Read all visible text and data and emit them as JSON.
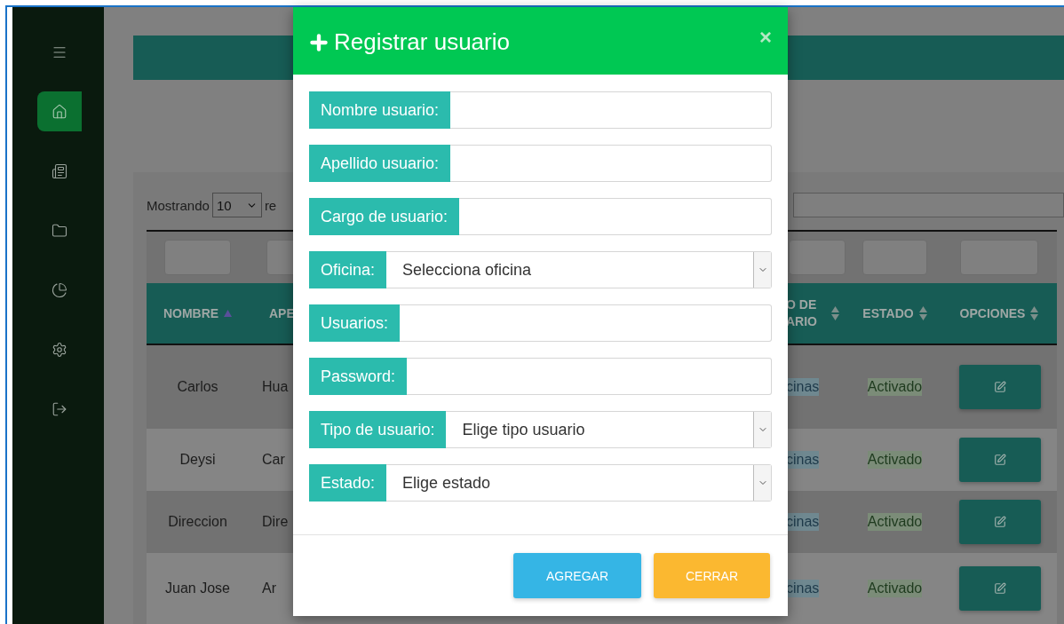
{
  "sidebar": {
    "items": [
      {
        "kind": "menu",
        "selected": false
      },
      {
        "kind": "home",
        "selected": true
      },
      {
        "kind": "news",
        "selected": false
      },
      {
        "kind": "folder",
        "selected": false
      },
      {
        "kind": "chart",
        "selected": false
      },
      {
        "kind": "settings",
        "selected": false
      },
      {
        "kind": "logout",
        "selected": false
      }
    ]
  },
  "table": {
    "length_label": "Mostrando",
    "length_value": "10",
    "length_suffix": "re",
    "columns": [
      {
        "label": "NOMBRE",
        "sorted": true
      },
      {
        "label": "APE"
      },
      {
        "label": "O DE ARIO",
        "sorted": false
      },
      {
        "label": "ESTADO",
        "sorted": false
      },
      {
        "label": "OPCIONES",
        "sorted": false
      }
    ],
    "rows": [
      {
        "nombre": "Carlos",
        "apellido": "Hua",
        "tipo": "cinas",
        "estado": "Activado"
      },
      {
        "nombre": "Deysi",
        "apellido": "Car",
        "tipo": "cinas",
        "estado": "Activado"
      },
      {
        "nombre": "Direccion",
        "apellido": "Dire",
        "tipo": "cinas",
        "estado": "Activado"
      },
      {
        "nombre": "Juan Jose",
        "apellido": "Ar",
        "tipo": "cinas",
        "estado": "Activado"
      }
    ]
  },
  "modal": {
    "title": "Registrar usuario",
    "close": "×",
    "fields": [
      {
        "kind": "text",
        "label": "Nombre usuario:"
      },
      {
        "kind": "text",
        "label": "Apellido usuario:"
      },
      {
        "kind": "text",
        "label": "Cargo de usuario:"
      },
      {
        "kind": "select",
        "label": "Oficina:",
        "value": "Selecciona oficina"
      },
      {
        "kind": "text",
        "label": "Usuarios:"
      },
      {
        "kind": "text",
        "label": "Password:"
      },
      {
        "kind": "select",
        "label": "Tipo de usuario:",
        "value": "Elige tipo usuario"
      },
      {
        "kind": "select",
        "label": "Estado:",
        "value": "Elige estado"
      }
    ],
    "buttons": [
      {
        "kind": "primary",
        "label": "AGREGAR"
      },
      {
        "kind": "warning",
        "label": "CERRAR"
      }
    ]
  }
}
